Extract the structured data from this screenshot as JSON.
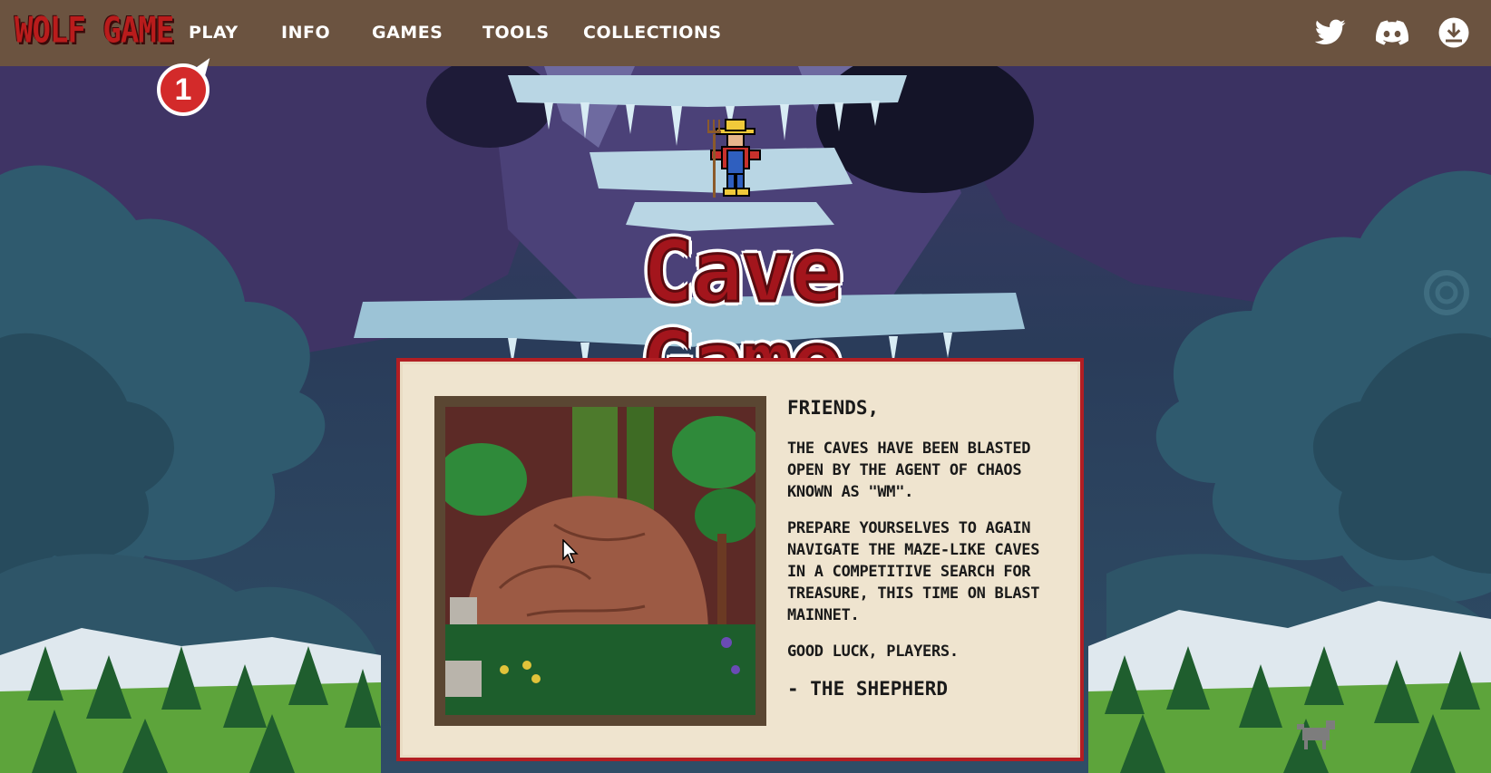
{
  "nav": {
    "logo": "WOLF GAME",
    "links": [
      "PLAY",
      "INFO",
      "GAMES",
      "TOOLS",
      "COLLECTIONS"
    ],
    "icons": [
      "twitter-icon",
      "discord-icon",
      "download-icon"
    ]
  },
  "annotation": {
    "step": "1"
  },
  "hero": {
    "title": "Cave Game"
  },
  "letter": {
    "greeting": "FRIENDS,",
    "paragraphs": [
      "THE CAVES HAVE BEEN BLASTED OPEN BY THE AGENT OF CHAOS KNOWN AS \"WM\".",
      "PREPARE YOURSELVES TO AGAIN NAVIGATE THE MAZE-LIKE CAVES IN A COMPETITIVE SEARCH FOR TREASURE, THIS TIME ON BLAST MAINNET.",
      "GOOD LUCK, PLAYERS."
    ],
    "signature": "- THE SHEPHERD"
  },
  "colors": {
    "navbar": "#6b5340",
    "title_red": "#a3151c",
    "panel_bg": "#efe4cf",
    "panel_border": "#b21e23"
  }
}
